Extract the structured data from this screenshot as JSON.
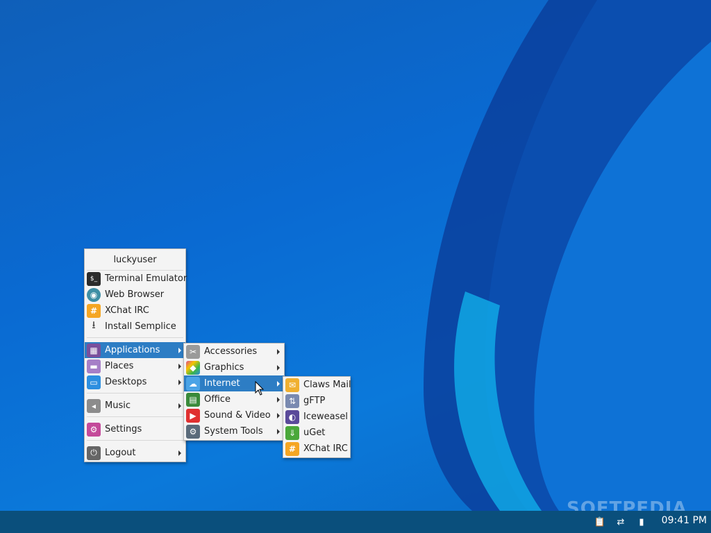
{
  "menu": {
    "user": "luckyuser",
    "favorites": [
      {
        "label": "Terminal Emulator",
        "icon": "terminal-icon",
        "glyph": "$_",
        "color": "#2b2b2b"
      },
      {
        "label": "Web Browser",
        "icon": "browser-icon",
        "glyph": "◉",
        "color": "#3e8fa5"
      },
      {
        "label": "XChat IRC",
        "icon": "xchat-icon",
        "glyph": "#",
        "color": "#f5a623"
      },
      {
        "label": "Install Semplice",
        "icon": "install-icon",
        "glyph": "⭳",
        "color": "#f4f4f4"
      }
    ],
    "applications": {
      "label": "Applications",
      "icon": "applications-icon",
      "glyph": "▦",
      "color": "#7a4f9c"
    },
    "places": {
      "label": "Places",
      "icon": "places-icon",
      "glyph": "▬",
      "color": "#a67fc7"
    },
    "desktops": {
      "label": "Desktops",
      "icon": "desktops-icon",
      "glyph": "▭",
      "color": "#2d8fe0"
    },
    "music": {
      "label": "Music",
      "icon": "music-icon",
      "glyph": "◂",
      "color": "#8c8c8c"
    },
    "settings": {
      "label": "Settings",
      "icon": "settings-icon",
      "glyph": "⚙",
      "color": "#c44a9a"
    },
    "logout": {
      "label": "Logout",
      "icon": "logout-icon",
      "glyph": "⏻",
      "color": "#666666"
    }
  },
  "applications_menu": [
    {
      "label": "Accessories",
      "icon": "accessories-icon",
      "glyph": "✂",
      "color": "#9a9a9a"
    },
    {
      "label": "Graphics",
      "icon": "graphics-icon",
      "glyph": "◆",
      "color": "#e04a8c"
    },
    {
      "label": "Internet",
      "icon": "internet-icon",
      "glyph": "☁",
      "color": "#4aa3e6"
    },
    {
      "label": "Office",
      "icon": "office-icon",
      "glyph": "▤",
      "color": "#3a8a3a"
    },
    {
      "label": "Sound & Video",
      "icon": "sound-video-icon",
      "glyph": "▶",
      "color": "#e03030"
    },
    {
      "label": "System Tools",
      "icon": "system-tools-icon",
      "glyph": "⚙",
      "color": "#5a6a7a"
    }
  ],
  "internet_menu": [
    {
      "label": "Claws Mail",
      "icon": "claws-mail-icon",
      "glyph": "✉",
      "color": "#f0b030"
    },
    {
      "label": "gFTP",
      "icon": "gftp-icon",
      "glyph": "⇅",
      "color": "#7a8ab0"
    },
    {
      "label": "Iceweasel",
      "icon": "iceweasel-icon",
      "glyph": "◐",
      "color": "#5a4a9a"
    },
    {
      "label": "uGet",
      "icon": "uget-icon",
      "glyph": "⇓",
      "color": "#4aa83a"
    },
    {
      "label": "XChat IRC",
      "icon": "xchat-icon",
      "glyph": "#",
      "color": "#f5a623"
    }
  ],
  "panel": {
    "clock": "09:41 PM",
    "watermark": "SOFTPEDIA",
    "tray": [
      {
        "icon": "clipboard-icon",
        "glyph": "📋"
      },
      {
        "icon": "network-icon",
        "glyph": "⇄"
      },
      {
        "icon": "battery-icon",
        "glyph": "▮"
      }
    ]
  }
}
